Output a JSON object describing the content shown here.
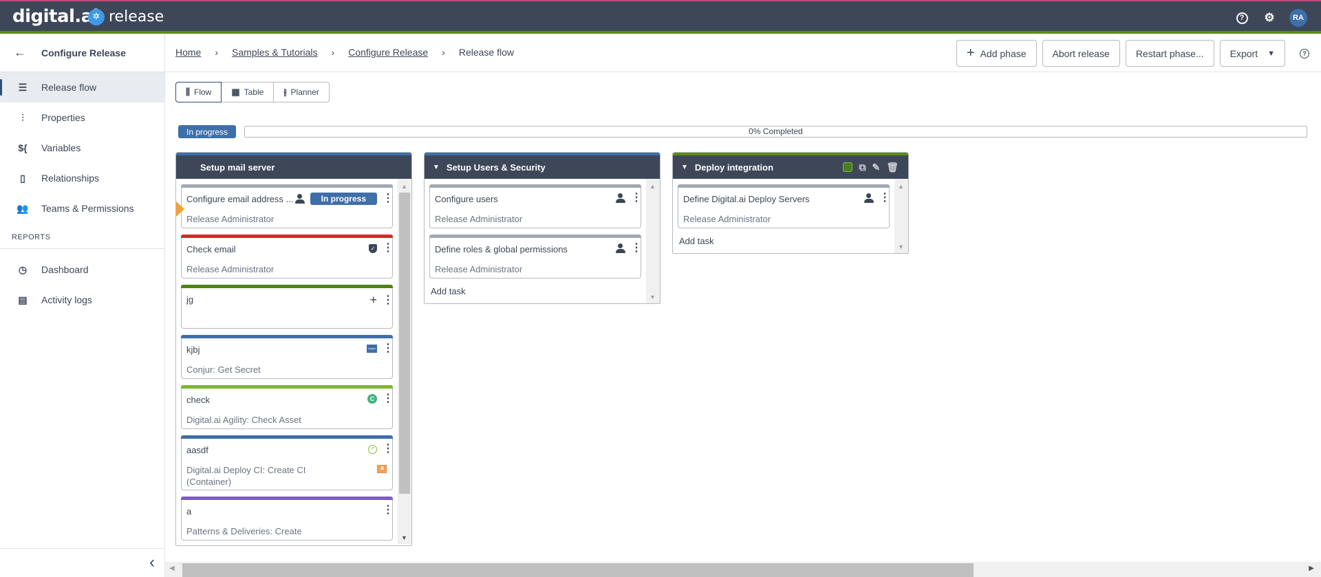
{
  "topbar": {
    "brand": "digital.ai",
    "product": "release",
    "user_initials": "RA",
    "icons": [
      "help-icon",
      "gear-icon",
      "avatar"
    ]
  },
  "sidebar": {
    "back_label": "Configure Release",
    "items": [
      {
        "label": "Release flow",
        "icon": "release-flow-icon",
        "active": true
      },
      {
        "label": "Properties",
        "icon": "sliders-icon"
      },
      {
        "label": "Variables",
        "icon": "variables-icon"
      },
      {
        "label": "Relationships",
        "icon": "document-icon"
      },
      {
        "label": "Teams & Permissions",
        "icon": "users-icon"
      }
    ],
    "reports_title": "REPORTS",
    "reports": [
      {
        "label": "Dashboard",
        "icon": "dashboard-icon"
      },
      {
        "label": "Activity logs",
        "icon": "activity-log-icon"
      }
    ]
  },
  "breadcrumb": {
    "items": [
      "Home",
      "Samples & Tutorials",
      "Configure Release"
    ],
    "current": "Release flow"
  },
  "actions": {
    "add_phase": "Add phase",
    "abort": "Abort release",
    "restart": "Restart phase...",
    "export": "Export"
  },
  "view_tabs": [
    {
      "label": "Flow",
      "active": true
    },
    {
      "label": "Table"
    },
    {
      "label": "Planner"
    }
  ],
  "release": {
    "status": "In progress",
    "progress_percent": 0,
    "progress_label": "0% Completed"
  },
  "phases": [
    {
      "title": "Setup mail server",
      "tasks": [
        {
          "title": "Configure email address ...",
          "subtitle": "Release Administrator",
          "badge": "In progress",
          "color": "#a3a8b0"
        },
        {
          "title": "Check email",
          "subtitle": "Release Administrator",
          "color": "#d9262b"
        },
        {
          "title": "jg",
          "subtitle": "",
          "color": "#4e8214"
        },
        {
          "title": "kjbj",
          "subtitle": "Conjur: Get Secret",
          "color": "#3e6fa8"
        },
        {
          "title": "check",
          "subtitle": "Digital.ai Agility: Check Asset",
          "color": "#80b52f"
        },
        {
          "title": "aasdf",
          "subtitle": "Digital.ai Deploy CI: Create CI (Container)",
          "color": "#3e6fa8"
        },
        {
          "title": "a",
          "subtitle": "Patterns & Deliveries: Create",
          "color": "#7c5bcc"
        }
      ]
    },
    {
      "title": "Setup Users & Security",
      "tasks": [
        {
          "title": "Configure users",
          "subtitle": "Release Administrator",
          "color": "#a3a8b0"
        },
        {
          "title": "Define roles & global permissions",
          "subtitle": "Release Administrator",
          "color": "#a3a8b0"
        }
      ],
      "add_task": "Add task"
    },
    {
      "title": "Deploy integration",
      "tasks": [
        {
          "title": "Define Digital.ai Deploy Servers",
          "subtitle": "Release Administrator",
          "color": "#a3a8b0"
        }
      ],
      "add_task": "Add task"
    }
  ]
}
